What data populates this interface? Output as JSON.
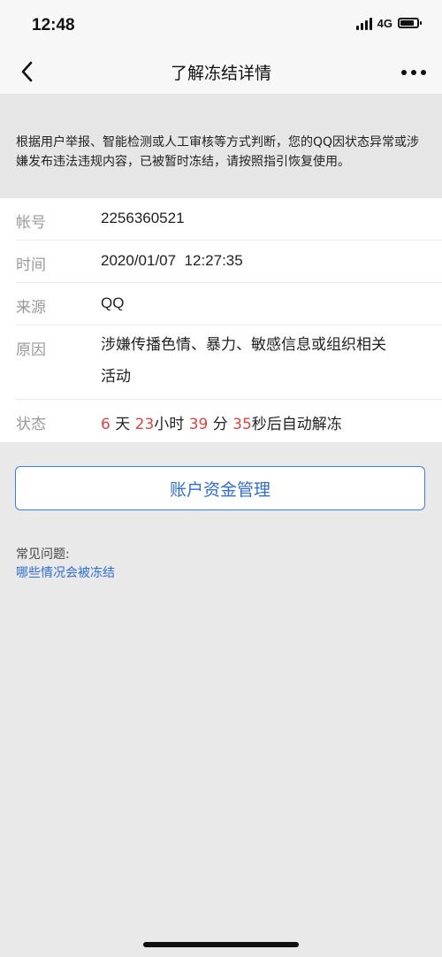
{
  "status_bar": {
    "time": "12:48",
    "network": "4G",
    "signal_icon": "signal-bars-icon",
    "battery_icon": "battery-icon"
  },
  "nav": {
    "title": "了解冻结详情",
    "back_icon": "chevron-left-icon",
    "more_icon": "more-dots-icon"
  },
  "notice": {
    "text": "根据用户举报、智能检测或人工审核等方式判断，您的QQ因状态异常或涉嫌发布违法违规内容，已被暂时冻结，请按照指引恢复使用。"
  },
  "details": {
    "account": {
      "label": "帐号",
      "value": "2256360521"
    },
    "time": {
      "label": "时间",
      "value": "2020/01/07  12:27:35"
    },
    "source": {
      "label": "来源",
      "value": "QQ"
    },
    "reason": {
      "label": "原因",
      "value": "涉嫌传播色情、暴力、敏感信息或组织相关活动"
    },
    "status": {
      "label": "状态",
      "days": "6",
      "days_unit": "天",
      "hours": "23",
      "hours_unit": "小时",
      "minutes": "39",
      "minutes_unit": "分",
      "seconds": "35",
      "seconds_unit": "秒后自动解冻"
    }
  },
  "funds_button": {
    "label": "账户资金管理"
  },
  "faq": {
    "title": "常见问题:",
    "link": "哪些情况会被冻结"
  },
  "colors": {
    "accent_blue": "#2f6fd6",
    "countdown_red": "#e64340",
    "background": "#e9e9e9"
  }
}
